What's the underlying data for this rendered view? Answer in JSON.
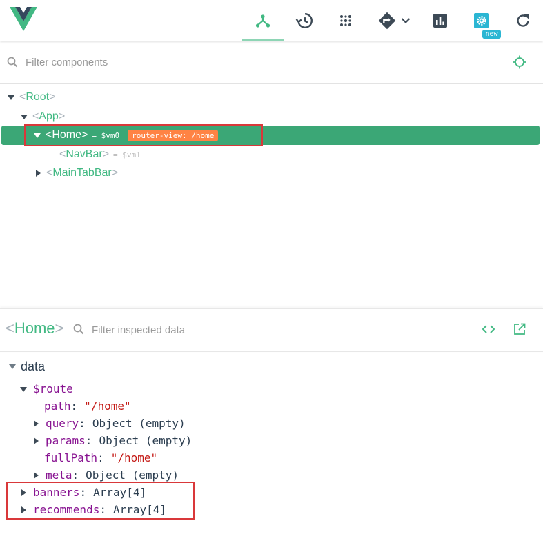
{
  "toolbar": {
    "tools": [
      {
        "name": "components",
        "icon": "component-tree-icon",
        "active": true
      },
      {
        "name": "history",
        "icon": "history-icon"
      },
      {
        "name": "vuex",
        "icon": "vuex-dots-icon"
      },
      {
        "name": "events",
        "icon": "routing-icon"
      },
      {
        "name": "performance",
        "icon": "bar-chart-icon"
      },
      {
        "name": "settings",
        "icon": "settings-gear-icon"
      },
      {
        "name": "refresh",
        "icon": "refresh-icon"
      }
    ],
    "new_badge": "new",
    "accent_color": "#42b983",
    "settings_color": "#2bb6d3"
  },
  "filter": {
    "placeholder": "Filter components"
  },
  "tree": {
    "root": {
      "open": "<",
      "name": "Root",
      "close": ">"
    },
    "app": {
      "open": "<",
      "name": "App",
      "close": ">"
    },
    "home": {
      "open": "<",
      "name": "Home",
      "close": ">",
      "ref": "= $vm0",
      "badge": "router-view: /home"
    },
    "navbar": {
      "open": "<",
      "name": "NavBar",
      "close": ">",
      "ref": "= $vm1"
    },
    "maintabbar": {
      "open": "<",
      "name": "MainTabBar",
      "close": ">"
    }
  },
  "inspector": {
    "open": "<",
    "name": "Home",
    "close": ">",
    "placeholder": "Filter inspected data"
  },
  "data_section": {
    "title": "data",
    "route_key": "$route",
    "path": {
      "key": "path",
      "value": "\"/home\""
    },
    "query": {
      "key": "query",
      "value": "Object (empty)"
    },
    "params": {
      "key": "params",
      "value": "Object (empty)"
    },
    "fullPath": {
      "key": "fullPath",
      "value": "\"/home\""
    },
    "meta": {
      "key": "meta",
      "value": "Object (empty)"
    },
    "banners": {
      "key": "banners",
      "value": "Array[4]"
    },
    "recommends": {
      "key": "recommends",
      "value": "Array[4]"
    }
  }
}
